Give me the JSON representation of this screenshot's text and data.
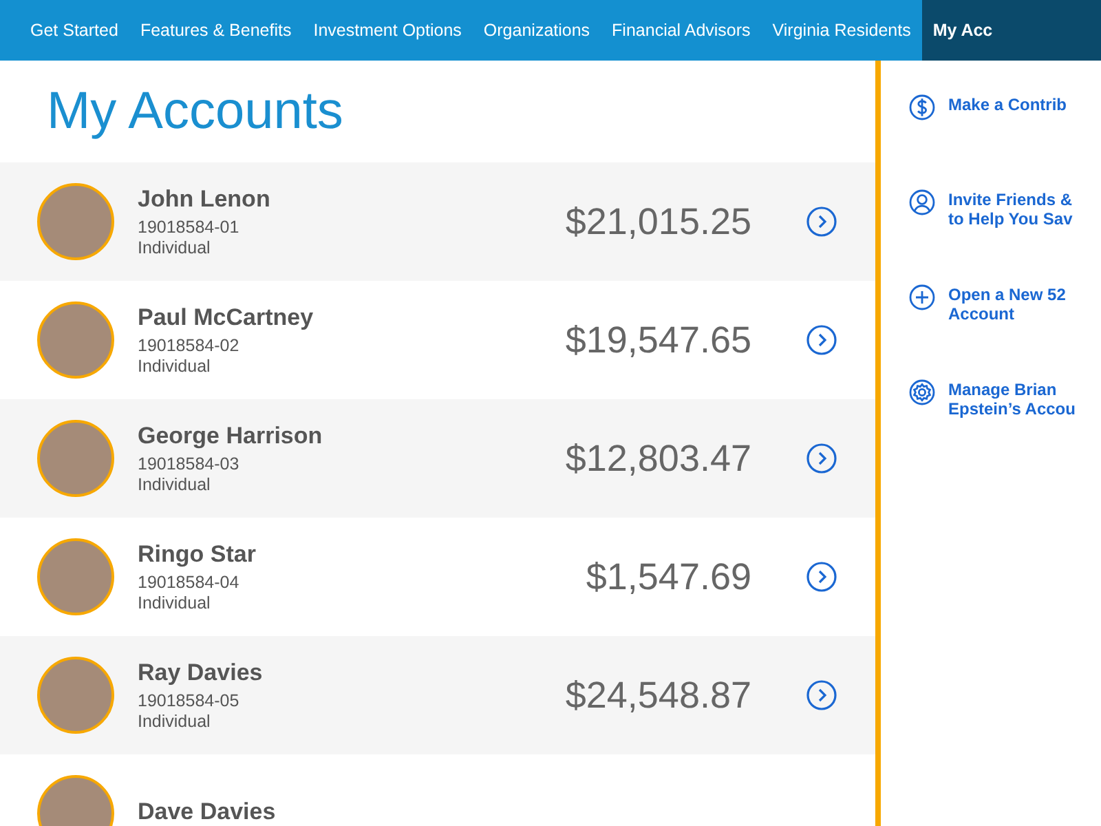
{
  "nav": [
    {
      "label": "Get Started",
      "selected": false
    },
    {
      "label": "Features & Benefits",
      "selected": false
    },
    {
      "label": "Investment Options",
      "selected": false
    },
    {
      "label": "Organizations",
      "selected": false
    },
    {
      "label": "Financial Advisors",
      "selected": false
    },
    {
      "label": "Virginia Residents",
      "selected": false
    },
    {
      "label": "My Acc",
      "selected": true
    }
  ],
  "title": "My Accounts",
  "accounts": [
    {
      "name": "John Lenon",
      "number": "19018584-01",
      "type": "Individual",
      "balance": "$21,015.25"
    },
    {
      "name": "Paul McCartney",
      "number": "19018584-02",
      "type": "Individual",
      "balance": "$19,547.65"
    },
    {
      "name": "George Harrison",
      "number": "19018584-03",
      "type": "Individual",
      "balance": "$12,803.47"
    },
    {
      "name": "Ringo Star",
      "number": "19018584-04",
      "type": "Individual",
      "balance": "$1,547.69"
    },
    {
      "name": "Ray Davies",
      "number": "19018584-05",
      "type": "Individual",
      "balance": "$24,548.87"
    },
    {
      "name": "Dave Davies"
    }
  ],
  "actions": [
    {
      "kind": "dollar",
      "lines": [
        "Make a Contrib"
      ]
    },
    {
      "kind": "person",
      "lines": [
        "Invite Friends &",
        "to Help You Sav"
      ]
    },
    {
      "kind": "plus",
      "lines": [
        "Open a New 52",
        "Account"
      ]
    },
    {
      "kind": "gear",
      "lines": [
        "Manage Brian",
        "Epstein’s Accou"
      ]
    }
  ]
}
